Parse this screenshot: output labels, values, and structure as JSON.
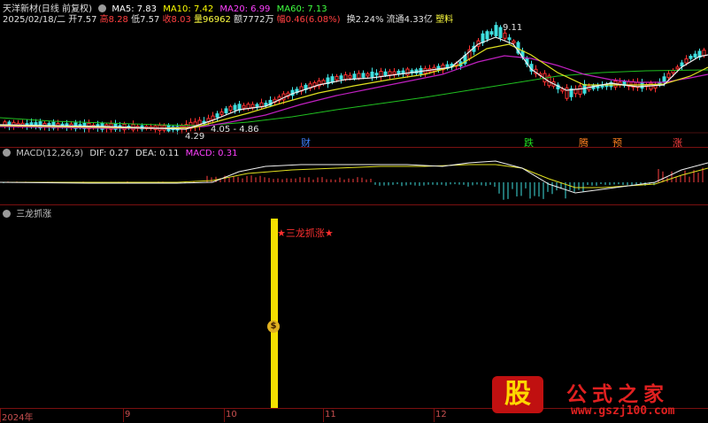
{
  "header": {
    "title": "天洋新材(日线 前复权)",
    "ma5": "MA5: 7.83",
    "ma10": "MA10: 7.42",
    "ma20": "MA20: 6.99",
    "ma60": "MA60: 7.13",
    "date": "2025/02/18/二",
    "open": "开7.57",
    "high": "高8.28",
    "low": "低7.57",
    "close": "收8.03",
    "volume": "量96962",
    "amount": "额7772万",
    "change": "幅0.46(6.08%)",
    "turnover": "换2.24%",
    "float": "流通4.33亿",
    "sector": "塑料",
    "colors": {
      "ma5": "#ffffff",
      "ma10": "#ffff00",
      "ma20": "#ff00ff",
      "ma60": "#00ff00"
    }
  },
  "price_chart": {
    "peak_label": "9.11",
    "low_label": "4.29",
    "range_label": "4.05 - 4.86",
    "markers": {
      "cai": "财",
      "die": "跌",
      "teng": "腾",
      "yu": "预",
      "zhang": "涨"
    }
  },
  "macd": {
    "title": "MACD(12,26,9)",
    "dif": "DIF: 0.27",
    "dea": "DEA: 0.11",
    "macd": "MACD: 0.31"
  },
  "indicator": {
    "title": "三龙抓涨",
    "signal_label": "★三龙抓涨★",
    "coin_glyph": "$"
  },
  "x_axis": {
    "labels": [
      "2024年",
      "9",
      "10",
      "11",
      "12"
    ]
  },
  "watermark": {
    "icon": "股",
    "name": "公式之家",
    "url": "www.gszj100.com"
  },
  "chart_data": {
    "type": "candlestick",
    "title": "天洋新材(日线 前复权)",
    "x_labels": [
      "2024年",
      "9",
      "10",
      "11",
      "12"
    ],
    "annotations": [
      {
        "label": "9.11",
        "value": 9.11
      },
      {
        "label": "4.29",
        "value": 4.29
      },
      {
        "label": "4.05 - 4.86",
        "values": [
          4.05,
          4.86
        ]
      }
    ],
    "series": [
      {
        "name": "MA5",
        "latest": 7.83
      },
      {
        "name": "MA10",
        "latest": 7.42
      },
      {
        "name": "MA20",
        "latest": 6.99
      },
      {
        "name": "MA60",
        "latest": 7.13
      }
    ],
    "macd": {
      "dif": 0.27,
      "dea": 0.11,
      "macd": 0.31
    }
  }
}
